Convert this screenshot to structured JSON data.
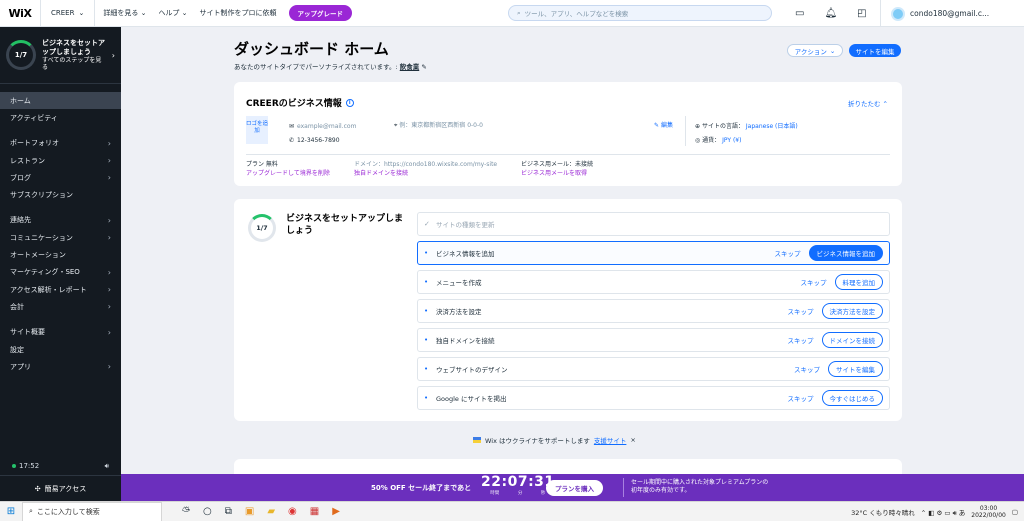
{
  "topbar": {
    "logo": "WiX",
    "site_name": "CREER",
    "menu": [
      "詳細を見る ⌄",
      "ヘルプ ⌄",
      "サイト制作をプロに依頼"
    ],
    "upgrade": "アップグレード",
    "search_placeholder": "ツール、アプリ、ヘルプなどを検索",
    "user_email": "condo180@gmail.c..."
  },
  "sidebar": {
    "setup_progress": "1/7",
    "setup_title": "ビジネスをセットアップしましょう",
    "setup_sub": "すべてのステップを見る",
    "items": [
      {
        "label": "ホーム",
        "chevron": false,
        "active": true
      },
      {
        "label": "アクティビティ",
        "chevron": false
      },
      {
        "gap": true
      },
      {
        "label": "ポートフォリオ",
        "chevron": true
      },
      {
        "label": "レストラン",
        "chevron": true
      },
      {
        "label": "ブログ",
        "chevron": true
      },
      {
        "label": "サブスクリプション",
        "chevron": false
      },
      {
        "gap": true
      },
      {
        "label": "連絡先",
        "chevron": true
      },
      {
        "label": "コミュニケーション",
        "chevron": true
      },
      {
        "label": "オートメーション",
        "chevron": false
      },
      {
        "label": "マーケティング・SEO",
        "chevron": true
      },
      {
        "label": "アクセス解析・レポート",
        "chevron": true
      },
      {
        "label": "会計",
        "chevron": true
      },
      {
        "gap": true
      },
      {
        "label": "サイト概要",
        "chevron": true
      },
      {
        "label": "設定",
        "chevron": false
      },
      {
        "label": "アプリ",
        "chevron": true
      }
    ],
    "time": "17:52",
    "quick_access": "簡易アクセス"
  },
  "main": {
    "title": "ダッシュボード ホーム",
    "subtitle": "あなたのサイトタイプでパーソナライズされています。:",
    "subtitle_link": "飲食業",
    "action_btn": "アクション",
    "edit_btn": "サイトを編集"
  },
  "info_card": {
    "title": "CREERのビジネス情報",
    "collapse": "折りたたむ",
    "logo_box": "ロゴを追加",
    "email": "example@mail.com",
    "phone": "12-3456-7890",
    "address": "例：東京都新宿区西新宿 0-0-0",
    "edit": "編集",
    "site_lang_label": "サイトの言語：",
    "site_lang": "Japanese (日本語)",
    "currency_label": "通貨：",
    "currency": "JPY (¥)",
    "plan_label": "プラン 無料",
    "plan_link": "アップグレードして境界を削除",
    "domain_label": "ドメイン：https://condo180.wixsite.com/my-site",
    "domain_link": "独自ドメインを接続",
    "email_label": "ビジネス用メール：未接続",
    "email_link": "ビジネス用メールを取得"
  },
  "setup_card": {
    "progress": "1/7",
    "title": "ビジネスをセットアップしましょう",
    "tasks": [
      {
        "label": "サイトの種類を更新",
        "done": true
      },
      {
        "label": "ビジネス情報を追加",
        "skip": "スキップ",
        "button": "ビジネス情報を追加",
        "primary": true
      },
      {
        "label": "メニューを作成",
        "skip": "スキップ",
        "button": "料理を追加"
      },
      {
        "label": "決済方法を設定",
        "skip": "スキップ",
        "button": "決済方法を設定"
      },
      {
        "label": "独自ドメインを接続",
        "skip": "スキップ",
        "button": "ドメインを接続"
      },
      {
        "label": "ウェブサイトのデザイン",
        "skip": "スキップ",
        "button": "サイトを編集"
      },
      {
        "label": "Google にサイトを掲出",
        "skip": "スキップ",
        "button": "今すぐはじめる"
      }
    ]
  },
  "ukraine": {
    "text": "Wix はウクライナをサポートします",
    "link": "支援サイト"
  },
  "promo": {
    "text": "50% OFF セール終了まであと",
    "time": "22:07:31",
    "units": [
      "時間",
      "分",
      "秒"
    ],
    "button": "プランを購入",
    "desc": "セール期間中に購入された対象プレミアムプランの初年度のみ有効です。"
  },
  "taskbar": {
    "search": "ここに入力して検索",
    "weather": "32°C くもり時々晴れ",
    "clock_time": "03:00",
    "clock_date": "2022/00/00"
  }
}
